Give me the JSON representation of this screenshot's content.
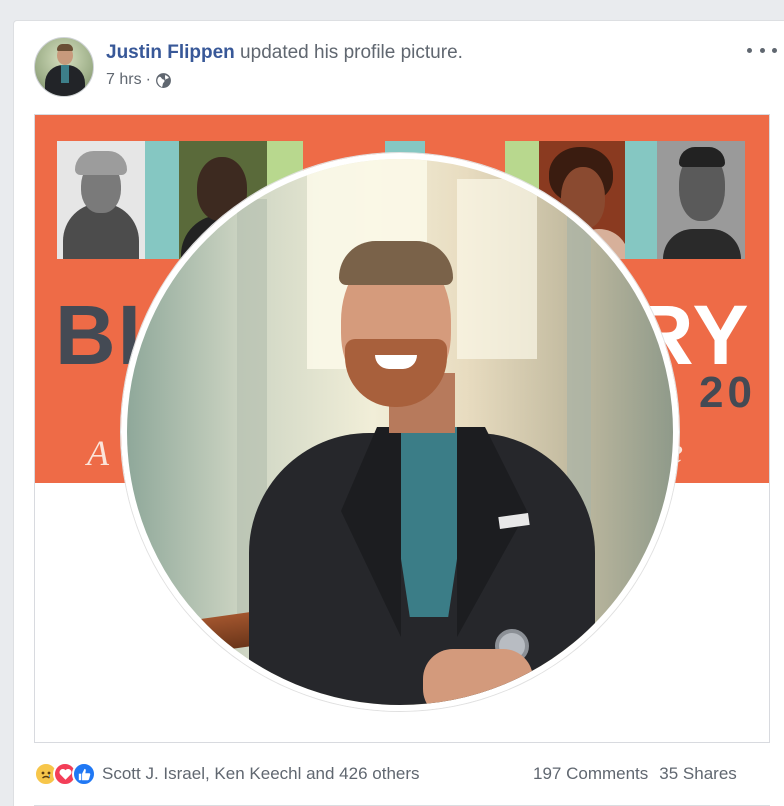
{
  "post": {
    "author": "Justin Flippen",
    "action": " updated his profile picture.",
    "timestamp": "7 hrs",
    "separator": "·",
    "privacy_icon": "globe-icon"
  },
  "cover": {
    "big_left": "BI",
    "big_right": "RY",
    "mid_right": "20",
    "script_left": "A",
    "script_right": "e"
  },
  "reactions": {
    "icons": [
      "sad-icon",
      "love-icon",
      "like-icon"
    ],
    "reactors": "Scott J. Israel, Ken Keechl and 426 others"
  },
  "stats": {
    "comments": "197 Comments",
    "shares": "35 Shares"
  },
  "colors": {
    "link": "#385898",
    "cover_orange": "#ee6b47",
    "teal_strip": "#85c7c2",
    "like_blue": "#2078f4",
    "love_red": "#f33e58"
  }
}
